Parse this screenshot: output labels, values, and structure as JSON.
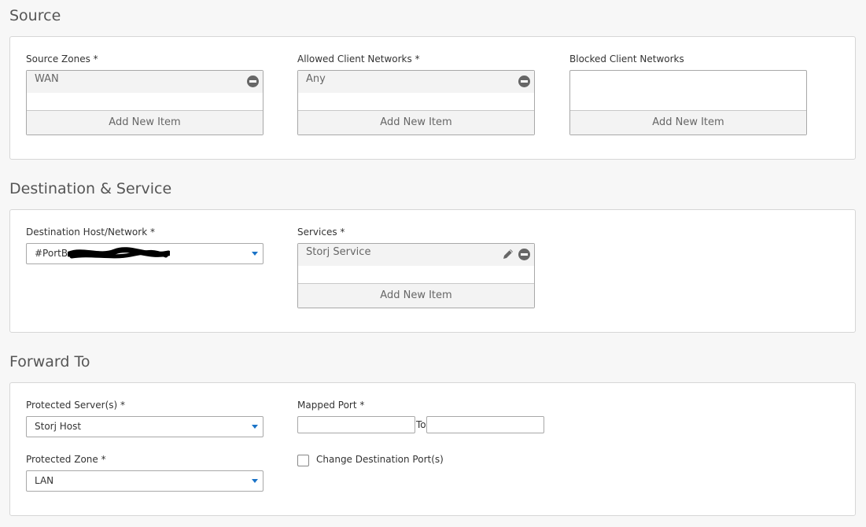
{
  "source": {
    "title": "Source",
    "source_zones": {
      "label": "Source Zones *",
      "items": [
        "WAN"
      ],
      "add_label": "Add New Item"
    },
    "allowed_client_networks": {
      "label": "Allowed Client Networks *",
      "items": [
        "Any"
      ],
      "add_label": "Add New Item"
    },
    "blocked_client_networks": {
      "label": "Blocked Client Networks",
      "items": [],
      "add_label": "Add New Item"
    }
  },
  "destination": {
    "title": "Destination & Service",
    "destination_host": {
      "label": "Destination Host/Network *",
      "value": "#PortB:"
    },
    "services": {
      "label": "Services *",
      "items": [
        "Storj Service"
      ],
      "add_label": "Add New Item"
    }
  },
  "forward": {
    "title": "Forward To",
    "protected_servers": {
      "label": "Protected Server(s) *",
      "value": "Storj Host"
    },
    "mapped_port": {
      "label": "Mapped Port *",
      "from_value": "",
      "to_label": "To",
      "to_value": ""
    },
    "protected_zone": {
      "label": "Protected Zone *",
      "value": "LAN"
    },
    "change_destination_port": {
      "label": "Change Destination Port(s)",
      "checked": false
    }
  },
  "colors": {
    "accent": "#1a73c7",
    "panel_border": "#d6d6d6",
    "page_background": "#f7f7f7"
  }
}
